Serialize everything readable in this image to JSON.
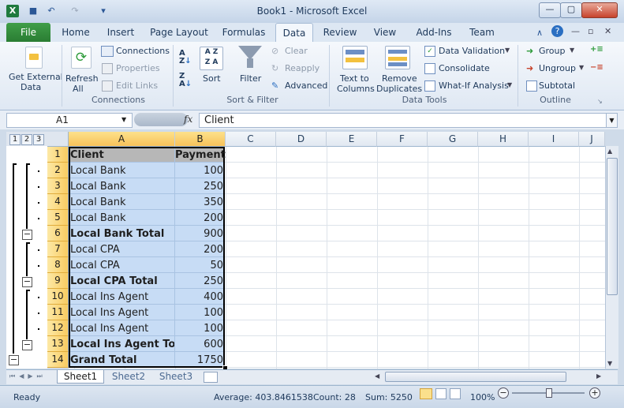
{
  "window": {
    "title": "Book1 - Microsoft Excel",
    "app_icon": "X"
  },
  "tabs": [
    "File",
    "Home",
    "Insert",
    "Page Layout",
    "Formulas",
    "Data",
    "Review",
    "View",
    "Add-Ins",
    "Team"
  ],
  "ribbon": {
    "get_external": "Get External",
    "get_external_2": "Data",
    "refresh": "Refresh",
    "refresh_2": "All",
    "connections": "Connections",
    "properties": "Properties",
    "edit_links": "Edit Links",
    "sort": "Sort",
    "filter": "Filter",
    "clear": "Clear",
    "reapply": "Reapply",
    "advanced": "Advanced",
    "text_to": "Text to",
    "columns": "Columns",
    "remove": "Remove",
    "duplicates": "Duplicates",
    "data_validation": "Data Validation",
    "consolidate": "Consolidate",
    "what_if": "What-If Analysis",
    "group": "Group",
    "ungroup": "Ungroup",
    "subtotal": "Subtotal",
    "groups": [
      "Connections",
      "Sort & Filter",
      "Data Tools",
      "Outline"
    ]
  },
  "formula_bar": {
    "name_box": "A1",
    "fx": "fx",
    "content": "Client"
  },
  "outline_levels": [
    "1",
    "2",
    "3"
  ],
  "columns": [
    "A",
    "B",
    "C",
    "D",
    "E",
    "F",
    "G",
    "H",
    "I",
    "J"
  ],
  "rows": [
    {
      "n": "1",
      "a": "Client",
      "b": "Payment",
      "bold": true,
      "header": true
    },
    {
      "n": "2",
      "a": "Local Bank",
      "b": "100"
    },
    {
      "n": "3",
      "a": "Local Bank",
      "b": "250"
    },
    {
      "n": "4",
      "a": "Local Bank",
      "b": "350"
    },
    {
      "n": "5",
      "a": "Local Bank",
      "b": "200"
    },
    {
      "n": "6",
      "a": "Local Bank Total",
      "b": "900",
      "bold": true
    },
    {
      "n": "7",
      "a": "Local CPA",
      "b": "200"
    },
    {
      "n": "8",
      "a": "Local CPA",
      "b": "50"
    },
    {
      "n": "9",
      "a": "Local CPA Total",
      "b": "250",
      "bold": true
    },
    {
      "n": "10",
      "a": "Local Ins Agent",
      "b": "400"
    },
    {
      "n": "11",
      "a": "Local Ins Agent",
      "b": "100"
    },
    {
      "n": "12",
      "a": "Local Ins Agent",
      "b": "100"
    },
    {
      "n": "13",
      "a": "Local Ins Agent Total",
      "b": "600",
      "bold": true
    },
    {
      "n": "14",
      "a": "Grand Total",
      "b": "1750",
      "bold": true
    }
  ],
  "sheets": [
    "Sheet1",
    "Sheet2",
    "Sheet3"
  ],
  "status": {
    "ready": "Ready",
    "average": "Average: 403.8461538",
    "count": "Count: 28",
    "sum": "Sum: 5250",
    "zoom": "100%"
  }
}
